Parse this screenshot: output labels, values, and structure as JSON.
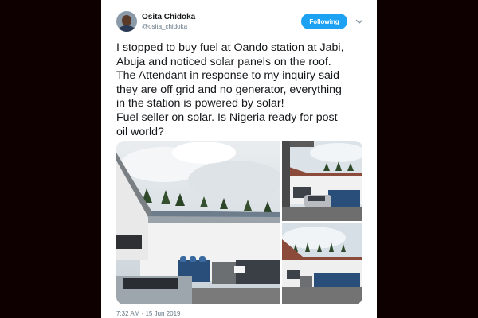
{
  "author": {
    "name": "Osita Chidoka",
    "handle": "@osita_chidoka",
    "avatar_icon": "profile-photo"
  },
  "follow_button": {
    "label": "Following",
    "color": "#1da1f2"
  },
  "menu_icon": "chevron-down-icon",
  "tweet": {
    "lines": [
      "I stopped to buy fuel at Oando station at Jabi,",
      "Abuja and noticed solar panels on the roof.",
      "The Attendant in response to my inquiry said",
      "they are off grid and no generator, everything",
      "in the station is powered by solar!",
      "Fuel seller on solar. Is Nigeria ready for post",
      "oil world?"
    ]
  },
  "media": {
    "count": 3,
    "photos": [
      {
        "subject": "station-building-with-solar-roof"
      },
      {
        "subject": "station-building-with-car"
      },
      {
        "subject": "station-building-wide-view"
      }
    ]
  },
  "timestamp": "7:32 AM - 15 Jun 2019",
  "colors": {
    "background": "#0f0000",
    "card": "#ffffff",
    "accent": "#1da1f2",
    "secondary_text": "#657786"
  }
}
